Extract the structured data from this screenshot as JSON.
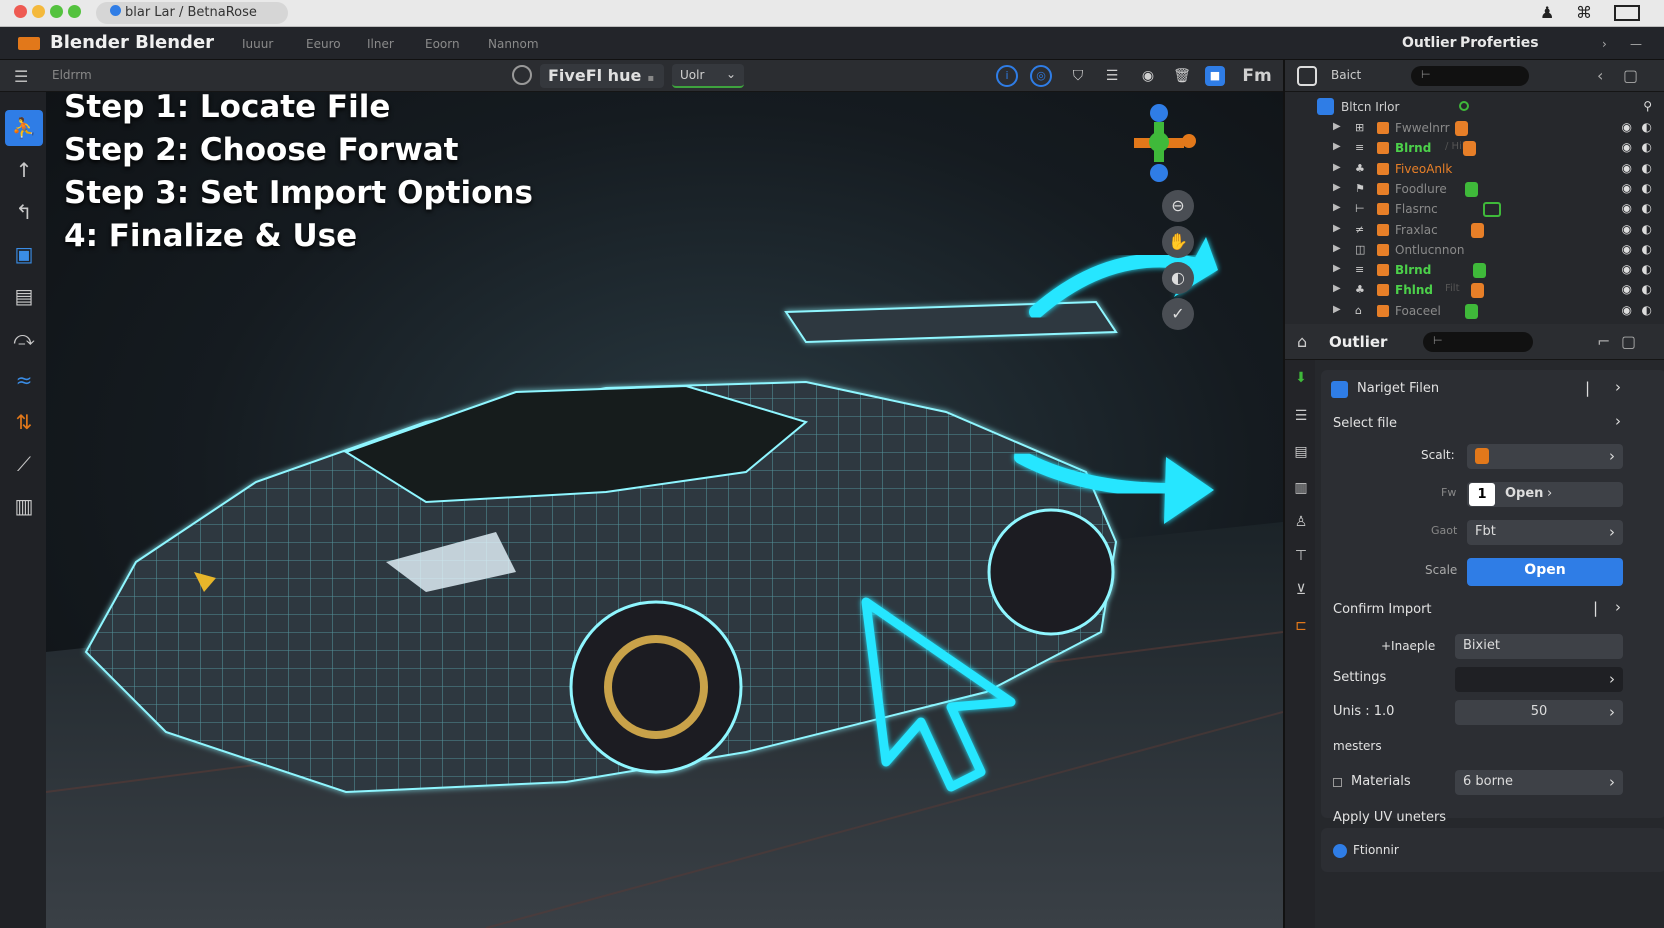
{
  "window": {
    "tab_title": "blar  Lar / BetnaRose"
  },
  "menubar": {
    "app_title": "Blender  Blender",
    "menus": [
      "Iuuur",
      "Eeuro",
      "Ilner",
      "Eoorn",
      "Nannom"
    ],
    "right_label_1": "Outlier",
    "right_label_2": "Proferties"
  },
  "viewport_header": {
    "editor": "Eldrrm",
    "mode": "FiveFl hue",
    "select": "Uolr",
    "fm_label": "Fm"
  },
  "steps": [
    "Step 1: Locate File",
    "Step 2: Choose Forwat",
    "Step 3: Set Import Options",
    "4:  Finalize & Use"
  ],
  "outliner": {
    "header_title": "Baict",
    "search": "⊢",
    "scene_collection": "Bltcn Irlor",
    "rows": [
      {
        "name": "Fwwelnrr",
        "badge": "orange"
      },
      {
        "name": "Blrnd",
        "suffix": "/ Hilc",
        "badge": "orange"
      },
      {
        "name": "FiveoAnlk",
        "badge": ""
      },
      {
        "name": "Foodlure",
        "badge": "green"
      },
      {
        "name": "Flasrnc",
        "badge": "green-outline"
      },
      {
        "name": "Fraxlac",
        "badge": "orange"
      },
      {
        "name": "Ontlucnnon",
        "badge": ""
      },
      {
        "name": "Blrnd",
        "badge": "green"
      },
      {
        "name": "Fhlnd",
        "suffix": "Filt",
        "badge": "orange"
      },
      {
        "name": "Foaceel",
        "badge": "green"
      }
    ]
  },
  "properties": {
    "header_title": "Outlier",
    "search": "⊢",
    "panel_title": "Nariget Filen",
    "select_file": "Select file",
    "scale_label": "Scalt:",
    "fw_label": "Fw",
    "open_number": "1",
    "open_label": "Open",
    "gaot_label": "Gaot",
    "format_value": "Fbt",
    "scale2_label": "Scale",
    "primary_button": "Open",
    "confirm_import": "Confirm Import",
    "incerple_label": "+Inaeple",
    "incerple_value": "Bixiet",
    "settings_label": "Settings",
    "units_label": "Unis : 1.0",
    "units_value": "50",
    "meters_label": "mesters",
    "materials_label": "Materials",
    "materials_value": "6 borne",
    "apply_uv": "Apply UV uneters",
    "footer_label": "Ftionnir"
  },
  "colors": {
    "accent_blue": "#2f7de6",
    "blender_orange": "#e77f28",
    "badge_green": "#3fb93a",
    "neon_cyan": "#25e6ff"
  }
}
